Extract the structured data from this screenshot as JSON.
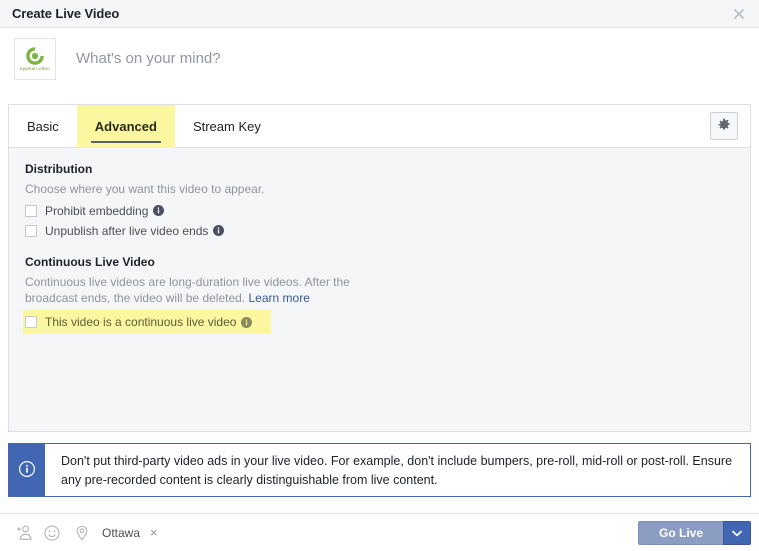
{
  "header": {
    "title": "Create Live Video",
    "close_icon": "close-icon"
  },
  "composer": {
    "avatar_label": "epiphan video",
    "placeholder": "What's on your mind?"
  },
  "tabs": [
    {
      "label": "Basic",
      "selected": false
    },
    {
      "label": "Advanced",
      "selected": true
    },
    {
      "label": "Stream Key",
      "selected": false
    }
  ],
  "settings_button": {
    "icon": "gear-icon"
  },
  "sections": [
    {
      "title": "Distribution",
      "description": "Choose where you want this video to appear.",
      "options": [
        {
          "label": "Prohibit embedding",
          "checked": false,
          "info_icon": "info-icon"
        },
        {
          "label": "Unpublish after live video ends",
          "checked": false,
          "info_icon": "info-icon"
        }
      ]
    },
    {
      "title": "Continuous Live Video",
      "description": "Continuous live videos are long-duration live videos. After the broadcast ends, the video will be deleted.",
      "link_label": "Learn more",
      "options": [
        {
          "label": "This video is a continuous live video",
          "checked": false,
          "info_icon": "info-icon",
          "highlighted": true
        }
      ]
    }
  ],
  "banner": {
    "icon": "info-icon",
    "text": "Don't put third-party video ads in your live video. For example, don't include bumpers, pre-roll, mid-roll or post-roll. Ensure any pre-recorded content is clearly distinguishable from live content."
  },
  "footer": {
    "tag_people_icon": "tag-person-icon",
    "feeling_icon": "smiley-icon",
    "location_icon": "location-pin-icon",
    "location_name": "Ottawa",
    "location_remove": "×",
    "go_live_label": "Go Live",
    "go_live_caret_icon": "chevron-down-icon"
  },
  "colors": {
    "highlight_yellow": "#fbf7a0",
    "facebook_blue": "#4267b2",
    "link_blue": "#385898",
    "panel_bg": "#f5f6f7",
    "go_live_disabled": "#8b9dc3"
  }
}
